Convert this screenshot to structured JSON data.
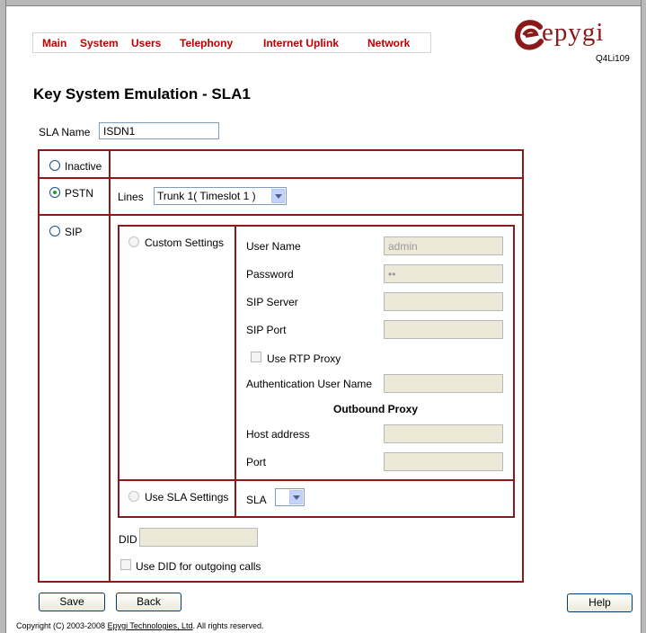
{
  "nav": {
    "main": "Main",
    "system": "System",
    "users": "Users",
    "telephony": "Telephony",
    "internet_uplink": "Internet Uplink",
    "network": "Network"
  },
  "logo": {
    "brand": "epygi",
    "model": "Q4Li109",
    "brand_color": "#8a1a1a"
  },
  "page": {
    "title": "Key System Emulation - SLA1"
  },
  "form": {
    "sla_name_label": "SLA Name",
    "sla_name_value": "ISDN1",
    "mode_inactive": "Inactive",
    "mode_pstn": "PSTN",
    "mode_sip": "SIP",
    "selected_mode": "PSTN",
    "lines_label": "Lines",
    "lines_value": "Trunk 1( Timeslot 1 )",
    "custom_settings_label": "Custom Settings",
    "use_sla_settings_label": "Use SLA Settings",
    "user_name_label": "User Name",
    "user_name_value": "admin",
    "password_label": "Password",
    "password_value": "••",
    "sip_server_label": "SIP Server",
    "sip_server_value": "",
    "sip_port_label": "SIP Port",
    "sip_port_value": "",
    "use_rtp_proxy_label": "Use RTP Proxy",
    "auth_user_name_label": "Authentication User Name",
    "auth_user_name_value": "",
    "outbound_proxy_heading": "Outbound Proxy",
    "host_address_label": "Host address",
    "host_address_value": "",
    "port_label": "Port",
    "port_value": "",
    "sla_label": "SLA",
    "sla_value": "",
    "did_label": "DID",
    "did_value": "",
    "use_did_label": "Use DID for outgoing calls"
  },
  "buttons": {
    "save": "Save",
    "back": "Back",
    "help": "Help"
  },
  "footer": {
    "prefix": "Copyright (C) 2003-2008 ",
    "link": "Epygi Technologies, Ltd",
    "suffix": ". All rights reserved."
  },
  "colors": {
    "nav_text": "#c00000",
    "table_border": "#8b1a1a"
  }
}
